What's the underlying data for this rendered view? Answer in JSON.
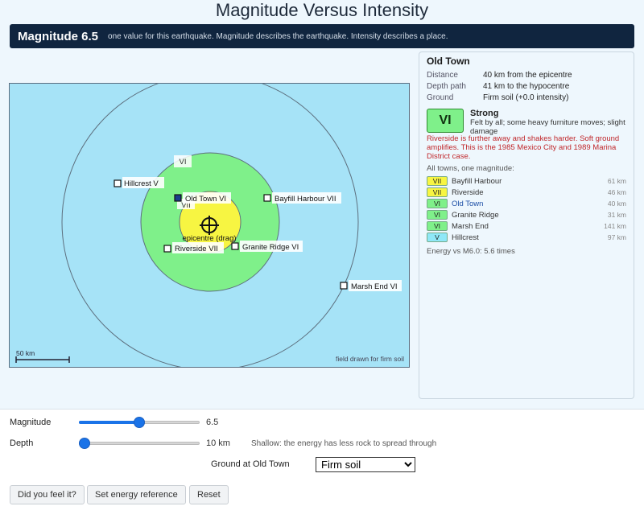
{
  "title": "Magnitude Versus Intensity",
  "banner": {
    "magnitude_label": "Magnitude 6.5",
    "description": "one value for this earthquake. Magnitude describes the earthquake. Intensity describes a place."
  },
  "map": {
    "zone_labels": [
      "VI",
      "VII"
    ],
    "epicentre_label": "epicentre (drag)",
    "towns": [
      {
        "name": "Hillcrest",
        "intensity": "V"
      },
      {
        "name": "Old Town",
        "intensity": "VI"
      },
      {
        "name": "Bayfill Harbour",
        "intensity": "VII"
      },
      {
        "name": "Riverside",
        "intensity": "VII"
      },
      {
        "name": "Granite Ridge",
        "intensity": "VI"
      },
      {
        "name": "Marsh End",
        "intensity": "VI"
      }
    ],
    "scale_label": "50 km",
    "footnote": "field drawn for firm soil"
  },
  "panel": {
    "town_name": "Old Town",
    "fields": [
      {
        "key": "Distance",
        "value": "40 km from the epicentre"
      },
      {
        "key": "Depth path",
        "value": "41 km to the hypocentre"
      },
      {
        "key": "Ground",
        "value": "Firm soil  (+0.0 intensity)"
      }
    ],
    "intensity": "VI",
    "intensity_name": "Strong",
    "felt": "Felt by all; some heavy furniture moves; slight damage",
    "warning": "Riverside is further away and shakes harder. Soft ground amplifies. This is the 1985 Mexico City and 1989 Marina District case.",
    "list_heading": "All towns, one magnitude:",
    "towns": [
      {
        "intensity": "VII",
        "name": "Bayfill Harbour",
        "distance": "61 km"
      },
      {
        "intensity": "VII",
        "name": "Riverside",
        "distance": "46 km"
      },
      {
        "intensity": "VI",
        "name": "Old Town",
        "distance": "40 km"
      },
      {
        "intensity": "VI",
        "name": "Granite Ridge",
        "distance": "31 km"
      },
      {
        "intensity": "VI",
        "name": "Marsh End",
        "distance": "141 km"
      },
      {
        "intensity": "V",
        "name": "Hillcrest",
        "distance": "97 km"
      }
    ],
    "energy": "Energy vs M6.0: 5.6 times"
  },
  "colors": {
    "V": "#8fe8f7",
    "VI": "#7ff08a",
    "VII": "#f7f542"
  },
  "controls": {
    "magnitude_label": "Magnitude",
    "magnitude_value": "6.5",
    "magnitude_fraction": 0.5,
    "depth_label": "Depth",
    "depth_value": "10 km",
    "depth_fraction": 0.0,
    "depth_hint": "Shallow: the energy has less rock to spread through",
    "ground_label": "Ground at Old Town",
    "ground_selected": "Firm soil",
    "buttons": {
      "felt": "Did you feel it?",
      "energy_ref": "Set energy reference",
      "reset": "Reset"
    }
  }
}
